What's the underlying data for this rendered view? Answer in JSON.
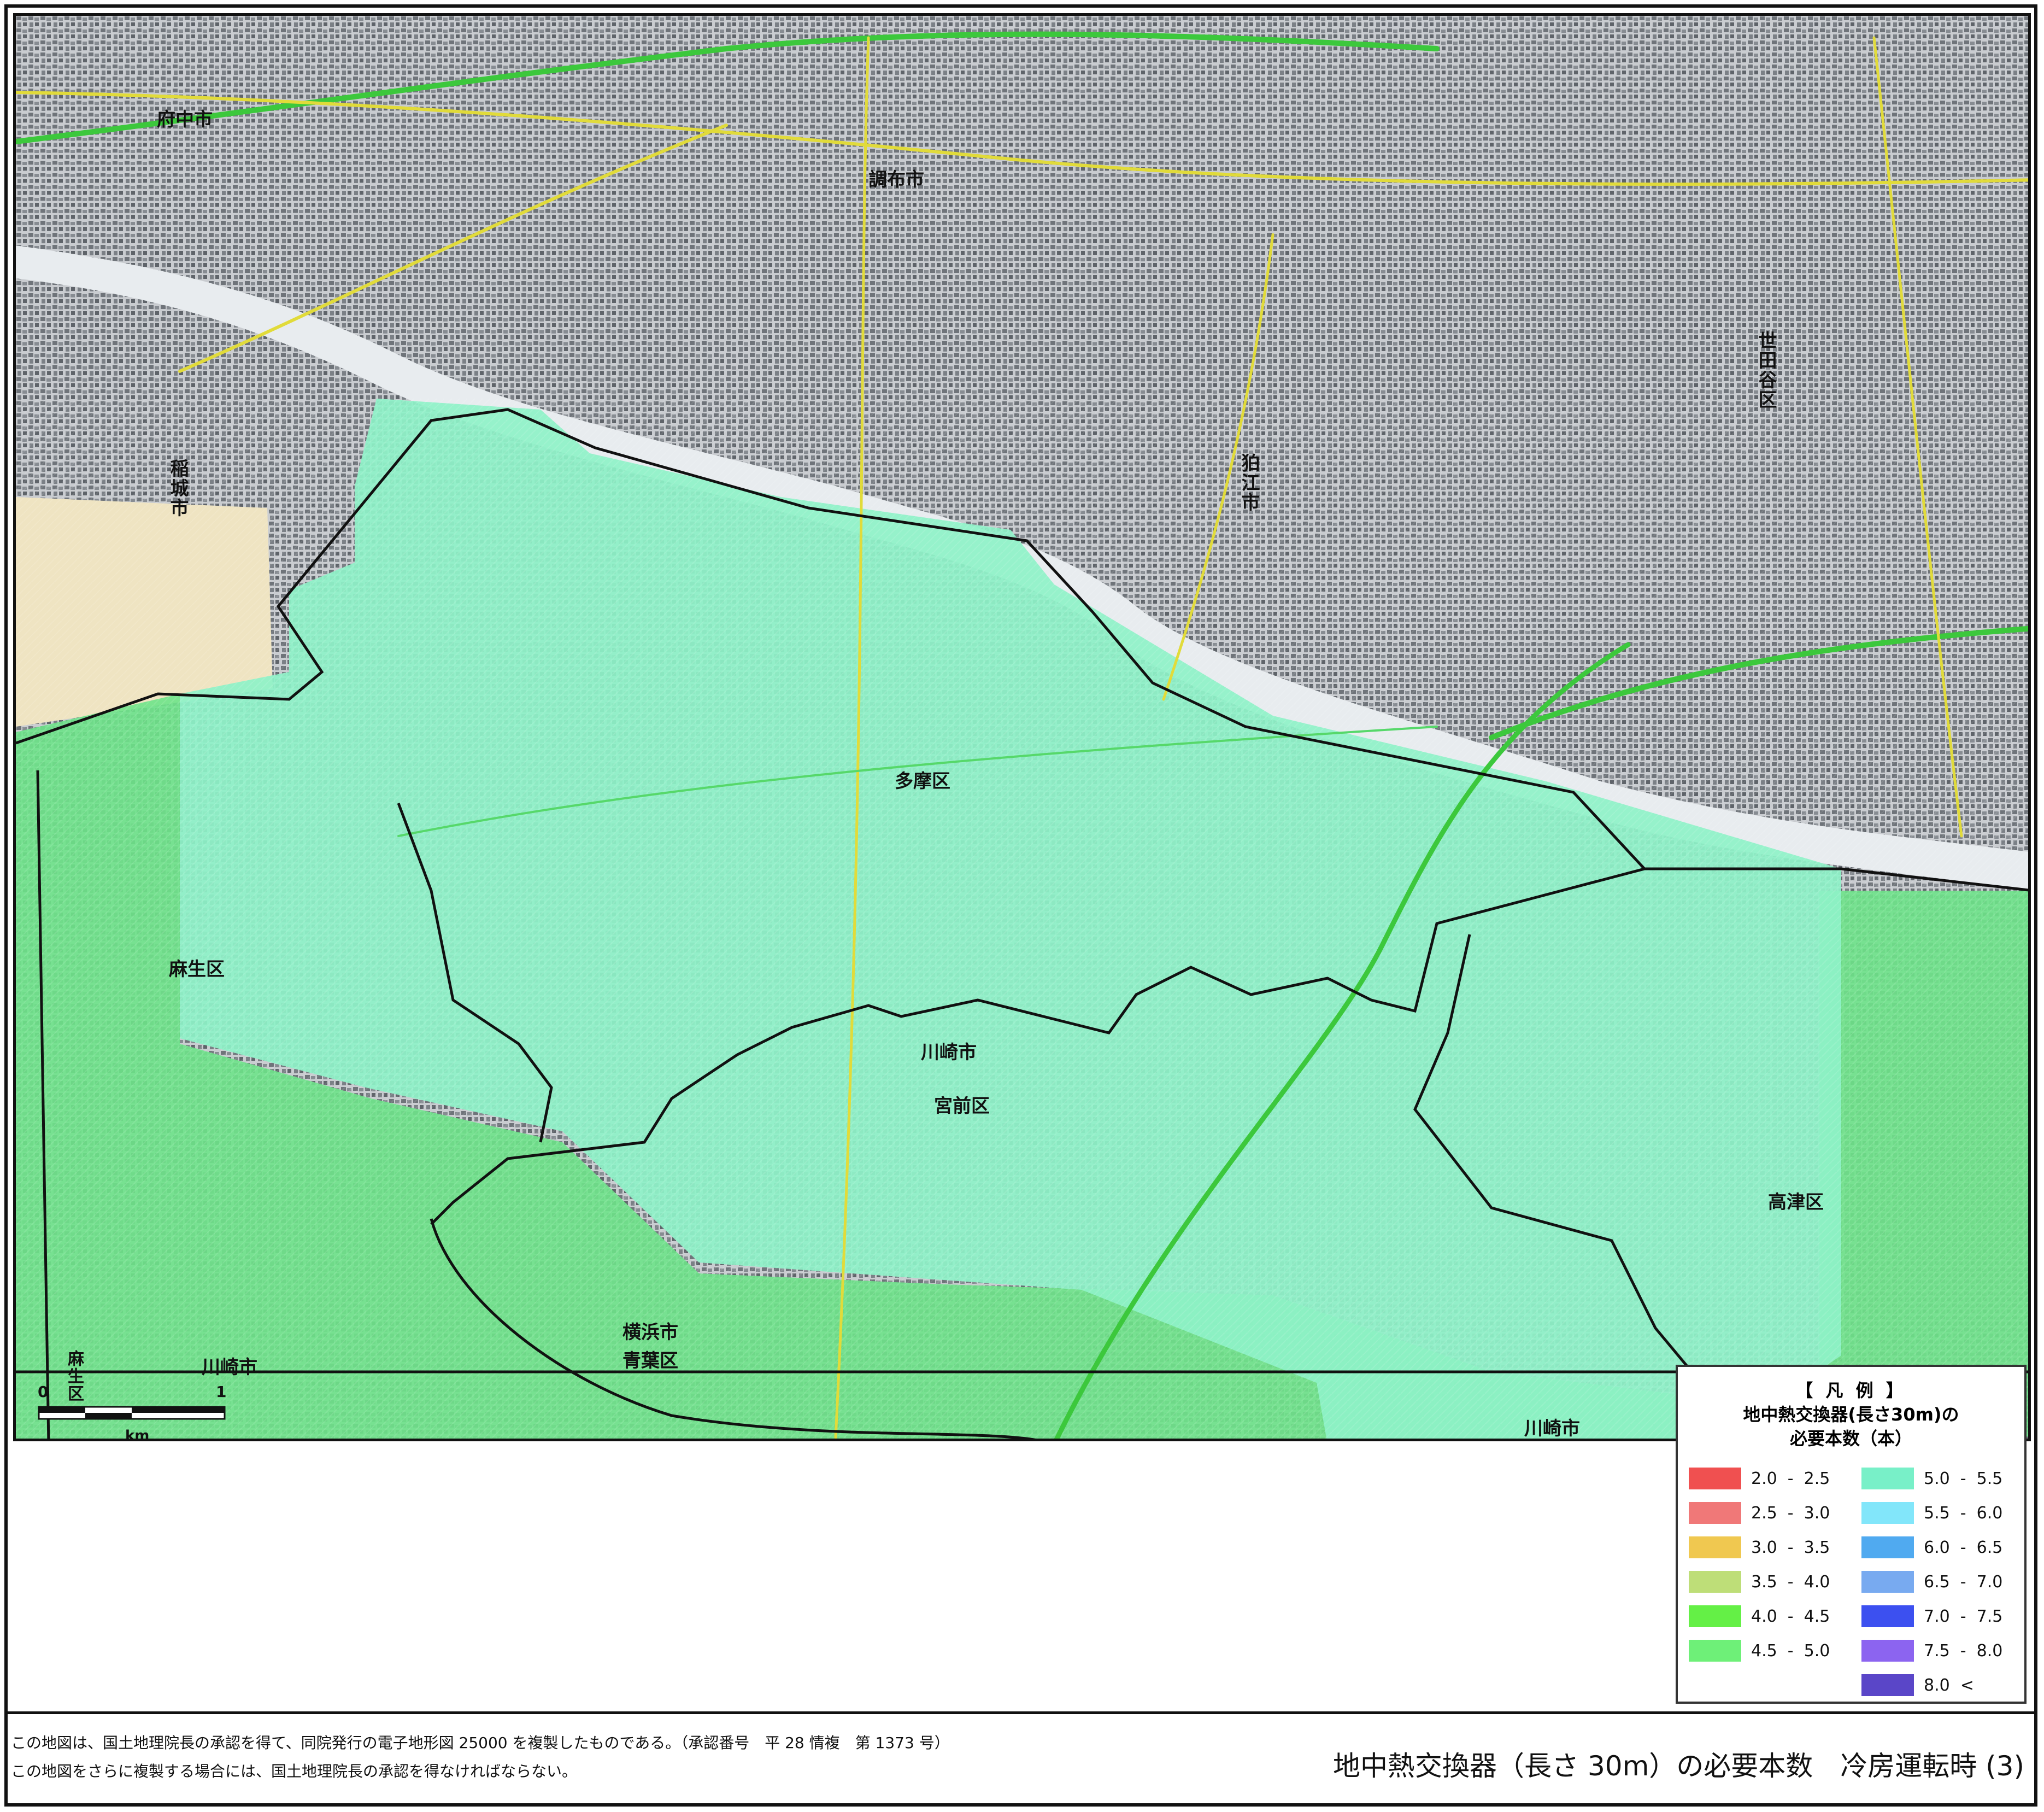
{
  "map": {
    "place_labels": {
      "fuchu": "府中市",
      "chofu": "調布市",
      "setagaya": "世田谷区",
      "komae": "狛江市",
      "inagi": "稲城市",
      "tama": "多摩区",
      "asao": "麻生区",
      "kawasaki_1": "川崎市",
      "miyamae": "宮前区",
      "takatsu": "高津区",
      "yokohama": "横浜市",
      "aoba": "青葉区",
      "kawasaki_2": "川崎市",
      "kawasaki_3": "川崎市",
      "asao_small": "麻生区"
    },
    "colors": {
      "green_zone": "#6ee38a",
      "cyan_zone": "#8ef2c8",
      "teal_zone": "#7fe9d2",
      "boundary": "#111111",
      "road_yellow": "#e1db3a",
      "road_green": "#3cc83c",
      "urban_gray": "#9aa0a6"
    }
  },
  "scale": {
    "zero": "0",
    "one": "1",
    "unit": "km"
  },
  "legend": {
    "title": "【 凡 例 】",
    "subtitle_line1": "地中熱交換器(長さ30m)の",
    "subtitle_line2": "必要本数（本）",
    "items": [
      {
        "label": "2.0  -  2.5",
        "color": "#f05050"
      },
      {
        "label": "2.5  -  3.0",
        "color": "#f07878"
      },
      {
        "label": "3.0  -  3.5",
        "color": "#f0c850"
      },
      {
        "label": "3.5  -  4.0",
        "color": "#bede78"
      },
      {
        "label": "4.0  -  4.5",
        "color": "#64f046"
      },
      {
        "label": "4.5  -  5.0",
        "color": "#6ef078"
      },
      {
        "label": "5.0  -  5.5",
        "color": "#78f0c8"
      },
      {
        "label": "5.5  -  6.0",
        "color": "#82e6fa"
      },
      {
        "label": "6.0  -  6.5",
        "color": "#50aaf0"
      },
      {
        "label": "6.5  -  7.0",
        "color": "#78aaf0"
      },
      {
        "label": "7.0  -  7.5",
        "color": "#3c50f0"
      },
      {
        "label": "7.5  -  8.0",
        "color": "#8c64f0"
      },
      {
        "label": "8.0  <",
        "color": "#5a46c8"
      }
    ]
  },
  "footer": {
    "note1": "この地図は、国土地理院長の承認を得て、同院発行の電子地形図 25000 を複製したものである。（承認番号　平 28 情複　第 1373 号）",
    "note2": "この地図をさらに複製する場合には、国土地理院長の承認を得なければならない。",
    "title": "地中熱交換器（長さ 30m）の必要本数　冷房運転時 (3)"
  }
}
